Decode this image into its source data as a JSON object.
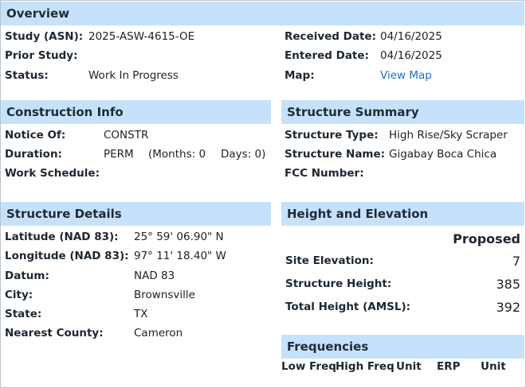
{
  "overview": {
    "title": "Overview",
    "study_label": "Study (ASN):",
    "study_value": "2025-ASW-4615-OE",
    "prior_label": "Prior Study:",
    "prior_value": "",
    "status_label": "Status:",
    "status_value": "Work In Progress",
    "received_label": "Received Date:",
    "received_value": "04/16/2025",
    "entered_label": "Entered Date:",
    "entered_value": "04/16/2025",
    "map_label": "Map:",
    "map_link": "View Map"
  },
  "construction": {
    "title": "Construction Info",
    "notice_label": "Notice Of:",
    "notice_value": "CONSTR",
    "duration_label": "Duration:",
    "duration_value": "PERM",
    "months_value": "(Months: 0",
    "days_value": "Days: 0)",
    "schedule_label": "Work Schedule:",
    "schedule_value": ""
  },
  "summary": {
    "title": "Structure Summary",
    "type_label": "Structure Type:",
    "type_value": "High Rise/Sky Scraper",
    "name_label": "Structure Name:",
    "name_value": "Gigabay Boca Chica",
    "fcc_label": "FCC Number:",
    "fcc_value": ""
  },
  "details": {
    "title": "Structure Details",
    "lat_label": "Latitude (NAD 83):",
    "lat_value": "25° 59' 06.90\" N",
    "lon_label": "Longitude (NAD 83):",
    "lon_value": "97° 11' 18.40\" W",
    "datum_label": "Datum:",
    "datum_value": "NAD 83",
    "city_label": "City:",
    "city_value": "Brownsville",
    "state_label": "State:",
    "state_value": "TX",
    "county_label": "Nearest County:",
    "county_value": "Cameron"
  },
  "height": {
    "title": "Height and Elevation",
    "column_header": "Proposed",
    "site_label": "Site Elevation:",
    "site_value": "7",
    "structure_label": "Structure Height:",
    "structure_value": "385",
    "total_label": "Total Height (AMSL):",
    "total_value": "392"
  },
  "frequencies": {
    "title": "Frequencies",
    "columns": [
      "Low Freq",
      "High Freq",
      "Unit",
      "ERP",
      "Unit"
    ]
  },
  "colors": {
    "header_bg": "#c6e2fb",
    "link": "#1a6fd0",
    "border": "#b9c3cc"
  }
}
